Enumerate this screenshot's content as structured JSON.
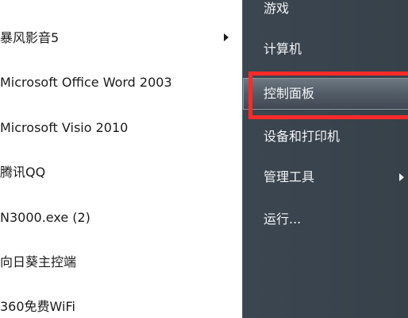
{
  "programs": [
    {
      "label": "暴风影音5",
      "has_submenu": true
    },
    {
      "label": "Microsoft Office Word 2003",
      "has_submenu": false
    },
    {
      "label": "Microsoft Visio 2010",
      "has_submenu": false
    },
    {
      "label": "腾讯QQ",
      "has_submenu": false
    },
    {
      "label": "N3000.exe (2)",
      "has_submenu": false
    },
    {
      "label": "向日葵主控端",
      "has_submenu": false
    },
    {
      "label": "360免费WiFi",
      "has_submenu": false
    }
  ],
  "system_items": [
    {
      "label": "游戏",
      "has_submenu": false
    },
    {
      "label": "计算机",
      "has_submenu": false
    },
    {
      "label": "控制面板",
      "has_submenu": false,
      "highlighted": true
    },
    {
      "label": "设备和打印机",
      "has_submenu": false
    },
    {
      "label": "管理工具",
      "has_submenu": true
    },
    {
      "label": "运行...",
      "has_submenu": false
    }
  ],
  "colors": {
    "highlight_border": "#ff2a2a",
    "right_pane_bg": "#3a444e",
    "right_pane_text": "#f2f4f6",
    "left_pane_text": "#1b1b1b"
  },
  "icons": {
    "submenu_arrow": "chevron-right-icon"
  }
}
